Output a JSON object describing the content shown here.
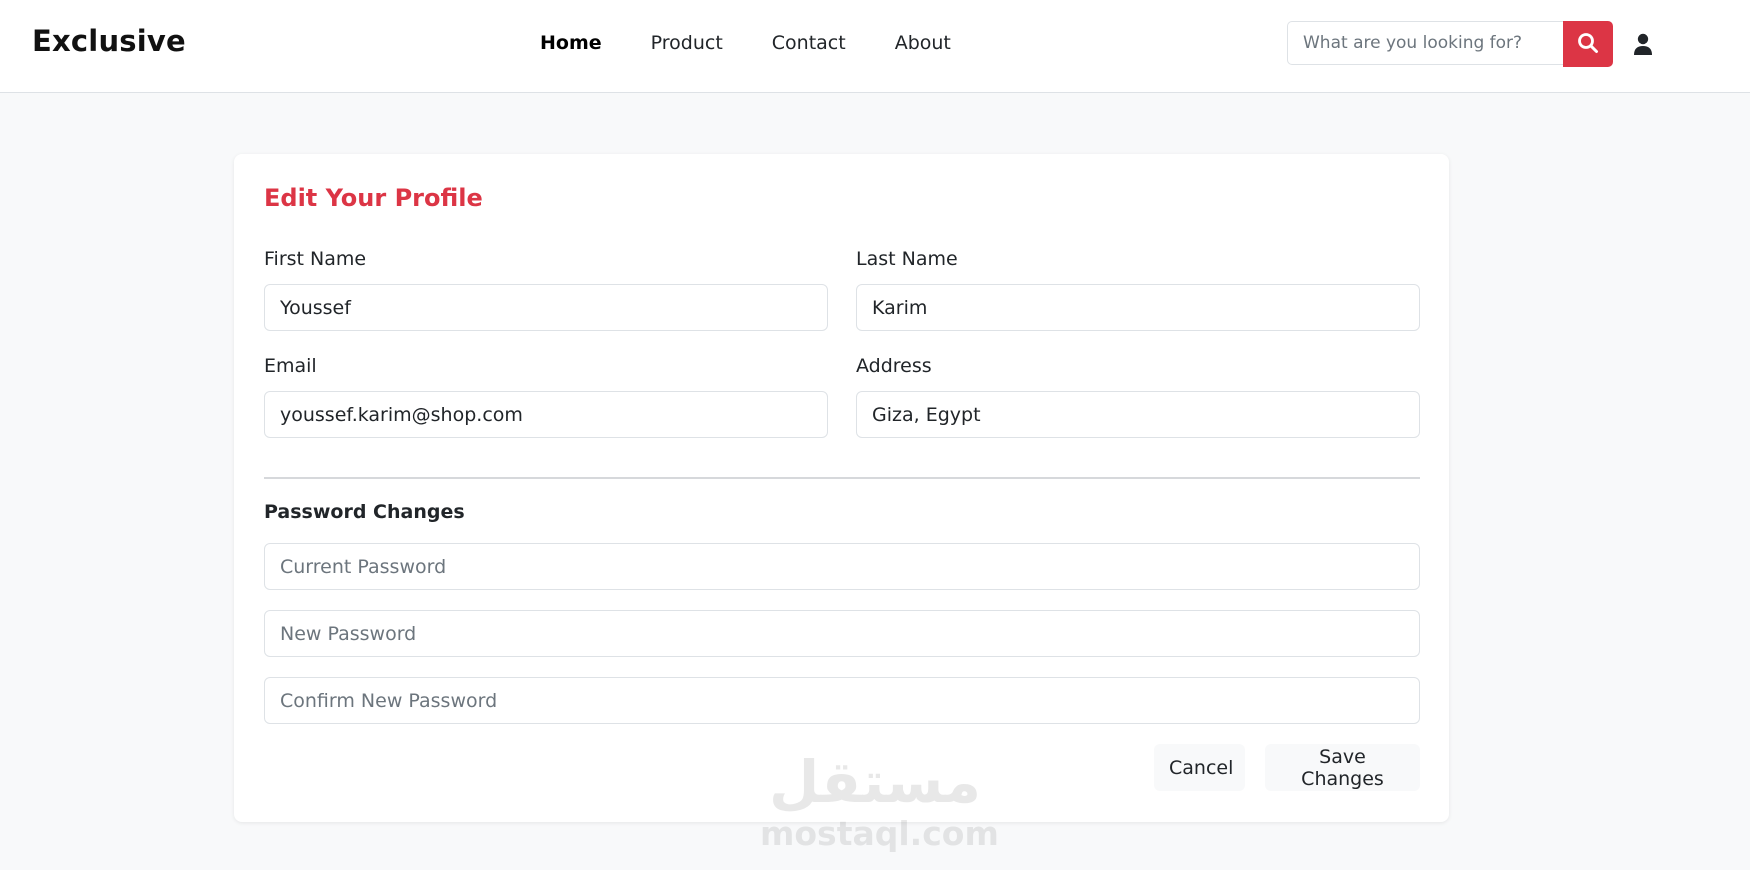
{
  "nav": {
    "brand": "Exclusive",
    "links": [
      "Home",
      "Product",
      "Contact",
      "About"
    ],
    "active_link": "Home",
    "search_placeholder": "What are you looking for?",
    "search_icon": "search-icon",
    "user_icon": "user-icon",
    "accent_color": "#dc3545"
  },
  "profile_form": {
    "title": "Edit Your Profile",
    "first_name": {
      "label": "First Name",
      "value": "Youssef"
    },
    "last_name": {
      "label": "Last Name",
      "value": "Karim"
    },
    "email": {
      "label": "Email",
      "value": "youssef.karim@shop.com"
    },
    "address": {
      "label": "Address",
      "value": "Giza, Egypt"
    },
    "password_section": {
      "title": "Password Changes",
      "current_placeholder": "Current Password",
      "new_placeholder": "New Password",
      "confirm_placeholder": "Confirm New Password"
    },
    "cancel_label": "Cancel",
    "save_label": "Save Changes"
  },
  "watermark": {
    "arabic": "مستقل",
    "latin": "mostaql.com"
  }
}
